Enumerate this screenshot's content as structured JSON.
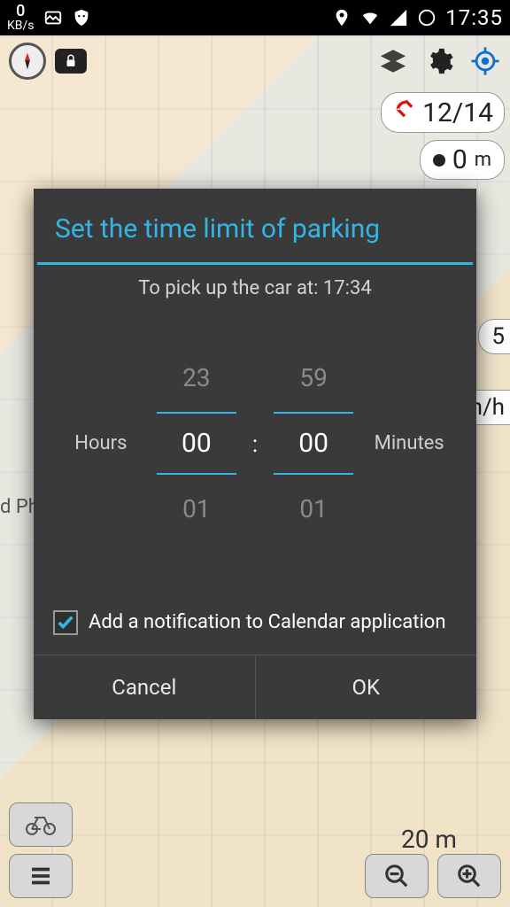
{
  "statusbar": {
    "kbs_value": "0",
    "kbs_label": "KB/s",
    "clock": "17:35"
  },
  "map": {
    "left_label": "d Ph",
    "scale_label": "20 m",
    "gps": "12/14",
    "distance_value": "0",
    "distance_unit": "m",
    "side1": "5",
    "side2": "n/h"
  },
  "dialog": {
    "title": "Set the time limit of parking",
    "subtitle": "To pick up the car at: 17:34",
    "hours_label": "Hours",
    "minutes_label": "Minutes",
    "hours_prev": "23",
    "hours_sel": "00",
    "hours_next": "01",
    "colon": ":",
    "mins_prev": "59",
    "mins_sel": "00",
    "mins_next": "01",
    "checkbox_checked": true,
    "checkbox_label": "Add a notification to Calendar application",
    "cancel": "Cancel",
    "ok": "OK"
  }
}
